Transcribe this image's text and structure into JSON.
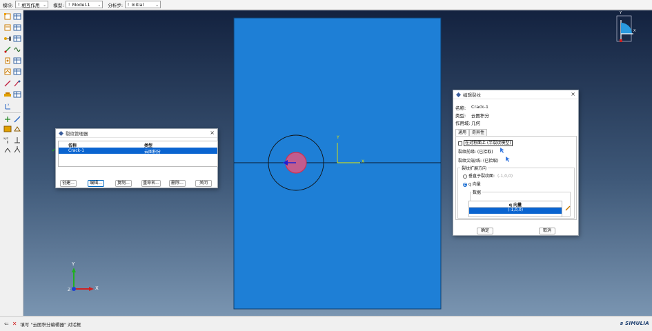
{
  "context_bar": {
    "module_label": "模块:",
    "module_value": "相互作用",
    "model_label": "模型:",
    "model_value": "Model-1",
    "step_label": "分析步:",
    "step_value": "Initial"
  },
  "status": {
    "text": "填写 \"云图积分编辑器\" 对话框",
    "brand": "SIMULIA"
  },
  "crack_manager": {
    "title": "裂纹管理器",
    "col_name": "名称",
    "col_type": "类型",
    "rows": [
      {
        "name": "Crack-1",
        "type": "云图积分"
      }
    ],
    "buttons": {
      "create": "创建...",
      "edit": "编辑...",
      "copy": "复制...",
      "rename": "重命名...",
      "delete": "删除...",
      "close": "关闭"
    }
  },
  "edit_crack": {
    "title": "编辑裂纹",
    "name_label": "名称:",
    "name_value": "Crack-1",
    "type_label": "类型:",
    "type_value": "云图积分",
    "domain_label": "作用域:",
    "domain_value": "几何",
    "tabs": [
      "通用",
      "奇异性"
    ],
    "symmetry_label": "在对称面上 (半裂纹模型)",
    "front_label": "裂纹前缘: (已拾取)",
    "tip_label": "裂纹尖端/线: (已拾取)",
    "direction_group": "裂纹扩展方向",
    "normal_option": "垂直于裂纹面:",
    "normal_value": "(-1,0,0)",
    "q_option": "q 向量",
    "data_group": "数据",
    "data_header": "q 向量",
    "data_value": "(-1,0,0)",
    "ok": "确定",
    "cancel": "取消"
  },
  "viewport": {
    "triad_center_y": "Y",
    "triad_center_x": "X",
    "triad_bl_y": "Y",
    "triad_bl_x": "X",
    "triad_bl_z": "Z",
    "view_cube_y": "Y",
    "view_cube_x": "X"
  },
  "colors": {
    "plate": "#1e7fd6",
    "selection": "#d04a6a",
    "accent": "#0a64d0"
  }
}
